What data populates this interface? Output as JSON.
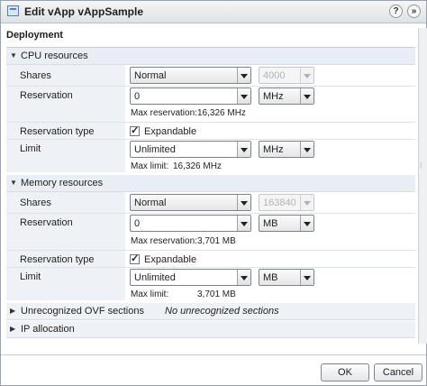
{
  "window": {
    "title": "Edit vApp vAppSample",
    "help_icon": "?",
    "expand_icon": "»"
  },
  "section": {
    "title": "Deployment"
  },
  "cpu": {
    "group_label": "CPU resources",
    "shares": {
      "label": "Shares",
      "level": "Normal",
      "value": "4000"
    },
    "reservation": {
      "label": "Reservation",
      "value": "0",
      "unit": "MHz",
      "max_label": "Max reservation:",
      "max_value": "16,326 MHz"
    },
    "reservation_type": {
      "label": "Reservation type",
      "option": "Expandable",
      "checked": true
    },
    "limit": {
      "label": "Limit",
      "value": "Unlimited",
      "unit": "MHz",
      "max_label": "Max limit:",
      "max_value": "16,326 MHz"
    }
  },
  "memory": {
    "group_label": "Memory resources",
    "shares": {
      "label": "Shares",
      "level": "Normal",
      "value": "163840"
    },
    "reservation": {
      "label": "Reservation",
      "value": "0",
      "unit": "MB",
      "max_label": "Max reservation:",
      "max_value": "3,701 MB"
    },
    "reservation_type": {
      "label": "Reservation type",
      "option": "Expandable",
      "checked": true
    },
    "limit": {
      "label": "Limit",
      "value": "Unlimited",
      "unit": "MB",
      "max_label": "Max limit:",
      "max_value": "3,701 MB"
    }
  },
  "ovf": {
    "label": "Unrecognized OVF sections",
    "value": "No unrecognized sections"
  },
  "ip": {
    "label": "IP allocation"
  },
  "buttons": {
    "ok": "OK",
    "cancel": "Cancel"
  }
}
